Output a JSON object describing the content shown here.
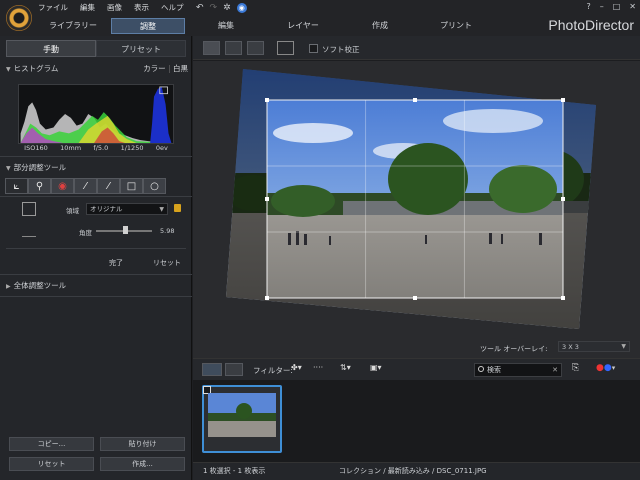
{
  "menu": [
    "ファイル",
    "編集",
    "画像",
    "表示",
    "ヘルプ"
  ],
  "window_controls": [
    "?",
    "–",
    "□",
    "✕"
  ],
  "brand": "PhotoDirector",
  "mode_tabs": [
    "ライブラリー",
    "調整"
  ],
  "main_tabs": [
    "編集",
    "レイヤー",
    "作成",
    "プリント"
  ],
  "left_panel": {
    "subtabs": [
      "手動",
      "プリセット"
    ],
    "histogram": {
      "title": "ヒストグラム",
      "mode_color": "カラー",
      "mode_bw": "白黒",
      "exif": [
        "ISO160",
        "10mm",
        "f/5.0",
        "1/1250",
        "0ev"
      ]
    },
    "regional_tools": {
      "title": "部分調整ツール",
      "area_label": "領域",
      "area_value": "オリジナル",
      "angle_label": "角度",
      "angle_value": "5.98",
      "angle_fraction": 0.53,
      "done": "完了",
      "reset": "リセット"
    },
    "global_tools_title": "全体調整ツール",
    "buttons": {
      "copy": "コピー...",
      "paste": "貼り付け",
      "reset": "リセット",
      "create": "作成..."
    }
  },
  "canvas": {
    "soft_proof": "ソフト校正",
    "overlay_label": "ツール オーバーレイ:",
    "overlay_value": "3 X 3"
  },
  "filmbar": {
    "filter_label": "フィルター:",
    "search_placeholder": "検索"
  },
  "status": {
    "selection": "1 枚選択 - 1 枚表示",
    "path": "コレクション / 最新読み込み / DSC_0711.JPG"
  },
  "colors": {
    "accent": "#3f8fd6",
    "active_mode": "#3d4f66",
    "lock": "#d7a21d"
  }
}
